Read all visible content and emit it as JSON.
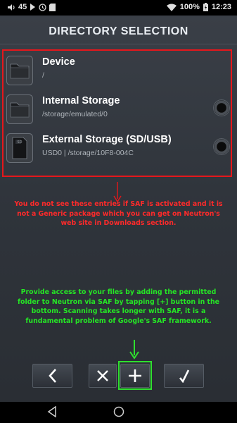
{
  "status_bar": {
    "notification_count": "45",
    "battery": "100%",
    "time": "12:23"
  },
  "header": {
    "title": "DIRECTORY SELECTION"
  },
  "storage_items": [
    {
      "name": "Device",
      "path": "/",
      "icon": "folder-icon"
    },
    {
      "name": "Internal Storage",
      "path": "/storage/emulated/0",
      "icon": "folder-icon"
    },
    {
      "name": "External Storage (SD/USB)",
      "path": "USD0 | /storage/10F8-004C",
      "icon": "sd-card-icon"
    }
  ],
  "annotations": {
    "red_note": "You do not see these entries if SAF is activated and it is not a Generic package which you can get on Neutron's web site in Downloads section.",
    "green_note": "Provide access to your files by adding the permitted folder to Neutron via SAF by tapping [+] button in the bottom. Scanning takes longer with SAF, it is a fundamental problem of Google's SAF framework.",
    "red_color": "#e6171b",
    "green_color": "#2fe02f"
  },
  "toolbar": {
    "buttons": [
      "back",
      "cancel",
      "add",
      "confirm"
    ]
  }
}
